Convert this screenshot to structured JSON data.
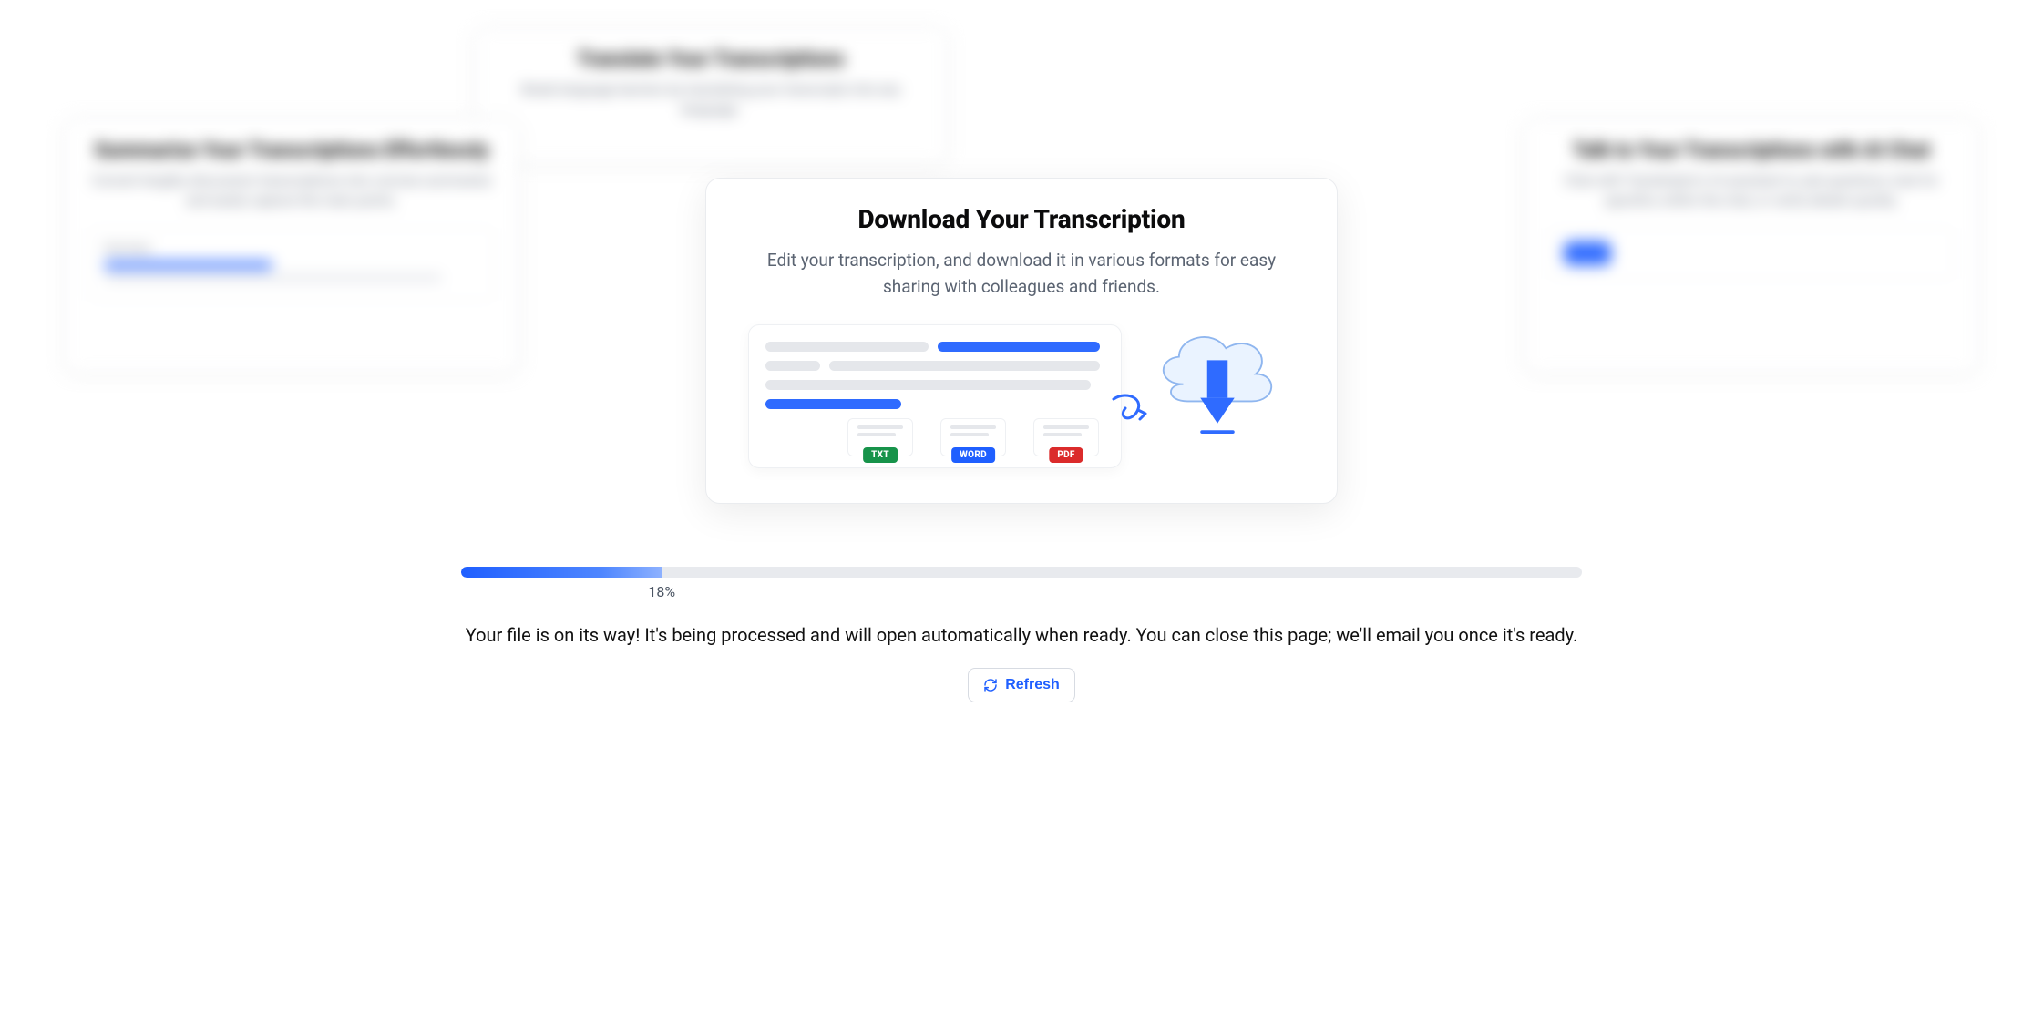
{
  "bg_cards": {
    "left": {
      "title": "Summarize Your Transcriptions Effortlessly",
      "desc": "Convert lengthy discussion transcriptions into concise summaries and easily capture the main points.",
      "panel_label": "Summary"
    },
    "top": {
      "title": "Translate Your Transcriptions",
      "desc": "Break language barriers by translating your transcripts into any language."
    },
    "right": {
      "title": "Talk to Your Transcriptions with AI Chat",
      "desc": "Chat with Transkriptor's AI assistant to ask questions, look for specifics within the chat, or verify details quickly."
    }
  },
  "modal": {
    "title": "Download Your Transcription",
    "subtitle": "Edit your transcription, and download it in various formats for easy sharing with colleagues and friends.",
    "formats": {
      "txt": "TXT",
      "word": "WORD",
      "pdf": "PDF"
    }
  },
  "progress": {
    "percent": 18,
    "percent_label": "18%",
    "status": "Your file is on its way! It's being processed and will open automatically when ready. You can close this page; we'll email you once it's ready.",
    "refresh_label": "Refresh"
  }
}
